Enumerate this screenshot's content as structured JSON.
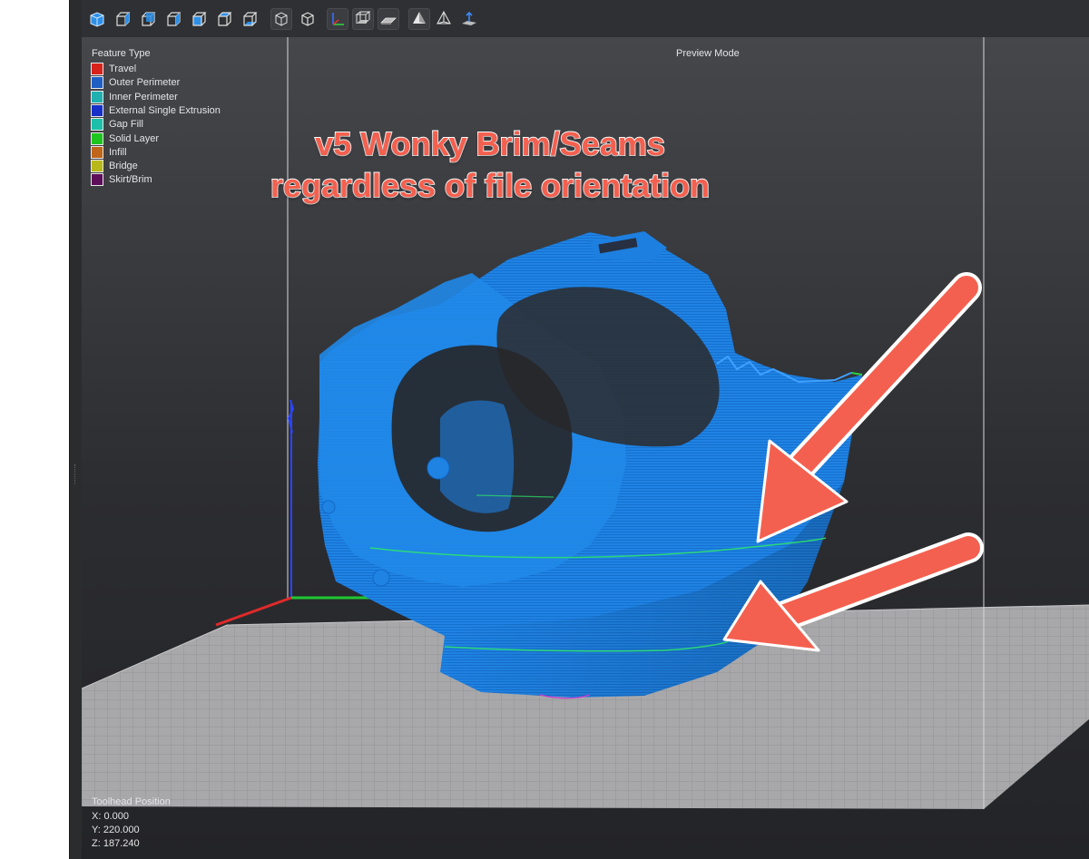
{
  "toolbar": {
    "buttons": [
      {
        "name": "view-iso-icon"
      },
      {
        "name": "view-front-icon"
      },
      {
        "name": "view-back-icon"
      },
      {
        "name": "view-left-icon"
      },
      {
        "name": "view-right-icon"
      },
      {
        "name": "view-top-icon"
      },
      {
        "name": "view-bottom-icon"
      },
      {
        "name": "perspective-icon"
      },
      {
        "name": "orthographic-icon"
      },
      {
        "name": "axes-toggle-icon"
      },
      {
        "name": "build-volume-toggle-icon"
      },
      {
        "name": "bed-toggle-icon"
      },
      {
        "name": "solid-view-icon"
      },
      {
        "name": "wireframe-view-icon"
      },
      {
        "name": "travel-lines-icon"
      }
    ]
  },
  "legend": {
    "title": "Feature Type",
    "items": [
      {
        "label": "Travel",
        "color": "#d7231c"
      },
      {
        "label": "Outer Perimeter",
        "color": "#1f5fc4"
      },
      {
        "label": "Inner Perimeter",
        "color": "#20b0b0"
      },
      {
        "label": "External Single Extrusion",
        "color": "#1630c8"
      },
      {
        "label": "Gap Fill",
        "color": "#1cc0a8"
      },
      {
        "label": "Solid Layer",
        "color": "#1ec51e"
      },
      {
        "label": "Infill",
        "color": "#c0661a"
      },
      {
        "label": "Bridge",
        "color": "#b8b81a"
      },
      {
        "label": "Skirt/Brim",
        "color": "#5c0f58"
      }
    ]
  },
  "preview_mode": "Preview Mode",
  "annotation": {
    "line1": "v5 Wonky Brim/Seams",
    "line2": "regardless of file orientation",
    "color": "#f4604f"
  },
  "toolhead": {
    "title": "Toolhead Position",
    "x": "X: 0.000",
    "y": "Y: 220.000",
    "z": "Z: 187.240"
  },
  "colors": {
    "model": "#1d7fe0",
    "seam": "#2ecf40",
    "bed": "#a9a9ab"
  }
}
